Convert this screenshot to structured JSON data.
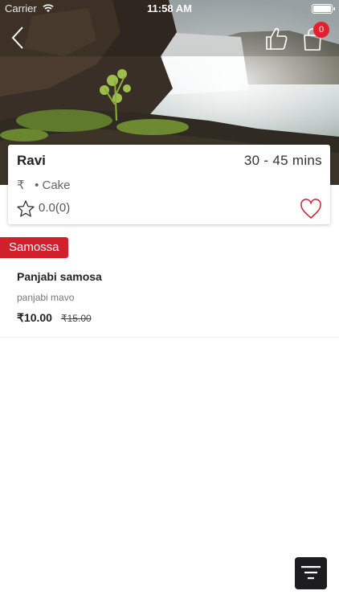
{
  "status_bar": {
    "carrier": "Carrier",
    "time": "11:58 AM"
  },
  "nav": {
    "back_icon": "chevron-left-icon",
    "like_icon": "thumbs-up-icon",
    "cart_icon": "shopping-bag-icon",
    "cart_count": "0"
  },
  "restaurant": {
    "name": "Ravi",
    "delivery_time": "30 - 45  mins",
    "price_symbol": "₹",
    "cuisine_sep": "•",
    "cuisine": "Cake",
    "rating": "0.0(0)"
  },
  "menu": {
    "category": "Samossa",
    "items": [
      {
        "name": "Panjabi samosa",
        "description": "panjabi mavo",
        "price": "₹10.00",
        "original_price": "₹15.00"
      }
    ]
  },
  "colors": {
    "accent_red": "#d11f2c",
    "badge_red": "#e5202e",
    "fab_dark": "#1d1d1f"
  }
}
